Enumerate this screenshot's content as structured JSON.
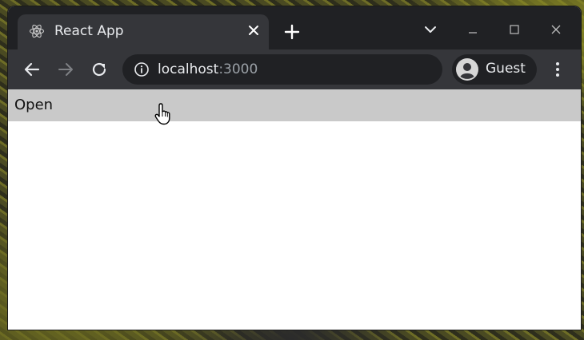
{
  "browser": {
    "tab": {
      "title": "React App",
      "favicon": "react-atom-icon",
      "close_icon": "close-icon"
    },
    "new_tab_icon": "plus-icon",
    "window_controls": [
      "chevron-down-icon",
      "minimize-icon",
      "maximize-icon",
      "close-icon"
    ],
    "toolbar": {
      "back_icon": "arrow-left-icon",
      "forward_icon": "arrow-right-icon",
      "reload_icon": "reload-icon",
      "address": {
        "info_icon": "info-icon",
        "host": "localhost",
        "port": ":3000"
      },
      "profile": {
        "avatar_icon": "account-circle-icon",
        "label": "Guest"
      },
      "menu_icon": "kebab-menu-icon"
    }
  },
  "page": {
    "open_button_label": "Open"
  },
  "colors": {
    "titlebar_bg": "#202124",
    "tab_bg": "#35363a",
    "toolbar_bg": "#35363a",
    "omnibox_bg": "#202124",
    "open_bar_bg": "#c9c9c9",
    "page_bg": "#ffffff"
  }
}
